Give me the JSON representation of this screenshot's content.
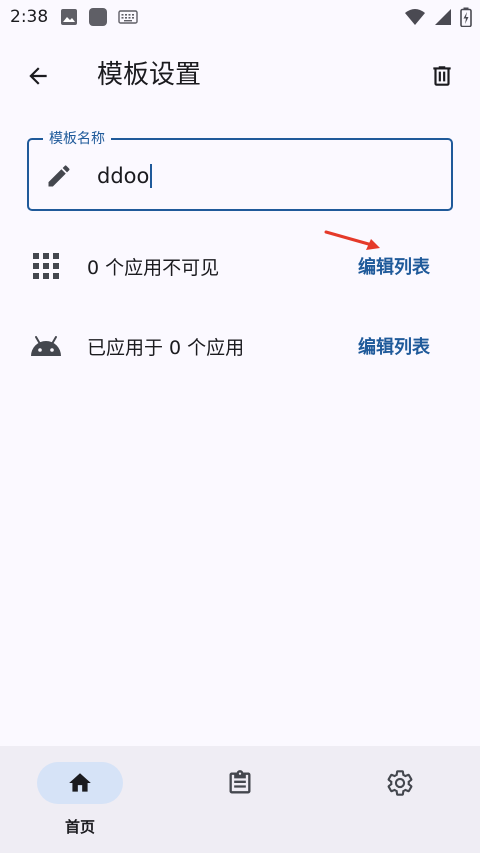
{
  "status_bar": {
    "time": "2:38",
    "left_icons": [
      "image-icon",
      "app-icon",
      "keyboard-icon"
    ],
    "right_icons": [
      "wifi-icon",
      "signal-icon",
      "battery-icon"
    ]
  },
  "app_bar": {
    "title": "模板设置",
    "back_icon": "arrow-left-icon",
    "delete_icon": "trash-icon"
  },
  "name_field": {
    "label": "模板名称",
    "value": "ddoo",
    "icon": "pencil-icon"
  },
  "rows": [
    {
      "icon": "grid-icon",
      "text": "0 个应用不可见",
      "action": "编辑列表"
    },
    {
      "icon": "android-icon",
      "text": "已应用于 0 个应用",
      "action": "编辑列表"
    }
  ],
  "bottom_nav": {
    "items": [
      {
        "icon": "home-icon",
        "label": "首页",
        "active": true
      },
      {
        "icon": "clipboard-icon",
        "label": "",
        "active": false
      },
      {
        "icon": "gear-icon",
        "label": "",
        "active": false
      }
    ]
  },
  "colors": {
    "accent": "#1f5a9a",
    "background": "#fbf9ff",
    "nav_background": "#efedf4",
    "active_pill": "#d6e3f7",
    "annotation": "#e53a2a"
  }
}
